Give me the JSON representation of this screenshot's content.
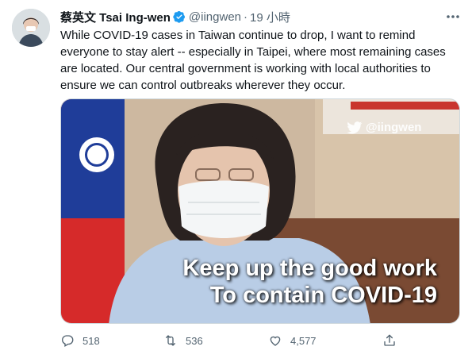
{
  "tweet": {
    "display_name": "蔡英文 Tsai Ing-wen",
    "handle": "@iingwen",
    "separator": "·",
    "timestamp": "19 小時",
    "text": "While COVID-19 cases in Taiwan continue to drop, I want to remind everyone to stay alert -- especially in Taipei, where most remaining cases are located. Our central government is working with local authorities to ensure we can control outbreaks wherever they occur.",
    "media": {
      "watermark": "@iingwen",
      "caption_line1": "Keep up the good work",
      "caption_line2": "To contain COVID-19"
    },
    "actions": {
      "replies": "518",
      "retweets": "536",
      "likes": "4,577"
    }
  },
  "colors": {
    "secondary_text": "#536471",
    "verified_blue": "#1d9bf0",
    "flag_red": "#d62a2a",
    "flag_blue": "#1f3d99"
  },
  "icons": [
    "verified-badge-icon",
    "more-icon",
    "reply-icon",
    "retweet-icon",
    "like-icon",
    "share-icon",
    "twitter-bird-icon"
  ]
}
